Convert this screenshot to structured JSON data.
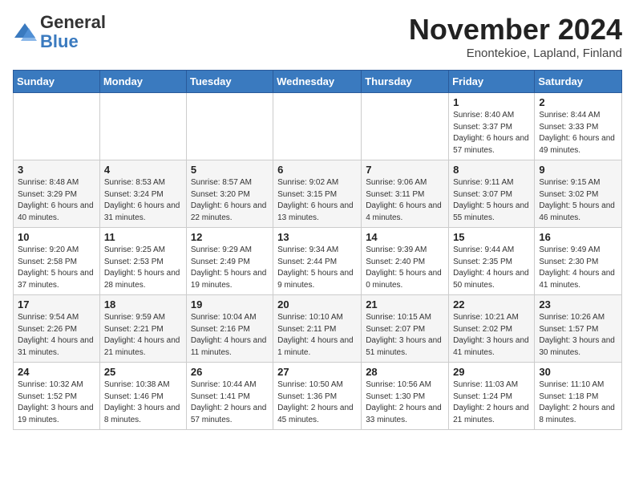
{
  "logo": {
    "general": "General",
    "blue": "Blue"
  },
  "header": {
    "month_year": "November 2024",
    "location": "Enontekioe, Lapland, Finland"
  },
  "days_of_week": [
    "Sunday",
    "Monday",
    "Tuesday",
    "Wednesday",
    "Thursday",
    "Friday",
    "Saturday"
  ],
  "weeks": [
    [
      {
        "day": "",
        "info": ""
      },
      {
        "day": "",
        "info": ""
      },
      {
        "day": "",
        "info": ""
      },
      {
        "day": "",
        "info": ""
      },
      {
        "day": "",
        "info": ""
      },
      {
        "day": "1",
        "info": "Sunrise: 8:40 AM\nSunset: 3:37 PM\nDaylight: 6 hours and 57 minutes."
      },
      {
        "day": "2",
        "info": "Sunrise: 8:44 AM\nSunset: 3:33 PM\nDaylight: 6 hours and 49 minutes."
      }
    ],
    [
      {
        "day": "3",
        "info": "Sunrise: 8:48 AM\nSunset: 3:29 PM\nDaylight: 6 hours and 40 minutes."
      },
      {
        "day": "4",
        "info": "Sunrise: 8:53 AM\nSunset: 3:24 PM\nDaylight: 6 hours and 31 minutes."
      },
      {
        "day": "5",
        "info": "Sunrise: 8:57 AM\nSunset: 3:20 PM\nDaylight: 6 hours and 22 minutes."
      },
      {
        "day": "6",
        "info": "Sunrise: 9:02 AM\nSunset: 3:15 PM\nDaylight: 6 hours and 13 minutes."
      },
      {
        "day": "7",
        "info": "Sunrise: 9:06 AM\nSunset: 3:11 PM\nDaylight: 6 hours and 4 minutes."
      },
      {
        "day": "8",
        "info": "Sunrise: 9:11 AM\nSunset: 3:07 PM\nDaylight: 5 hours and 55 minutes."
      },
      {
        "day": "9",
        "info": "Sunrise: 9:15 AM\nSunset: 3:02 PM\nDaylight: 5 hours and 46 minutes."
      }
    ],
    [
      {
        "day": "10",
        "info": "Sunrise: 9:20 AM\nSunset: 2:58 PM\nDaylight: 5 hours and 37 minutes."
      },
      {
        "day": "11",
        "info": "Sunrise: 9:25 AM\nSunset: 2:53 PM\nDaylight: 5 hours and 28 minutes."
      },
      {
        "day": "12",
        "info": "Sunrise: 9:29 AM\nSunset: 2:49 PM\nDaylight: 5 hours and 19 minutes."
      },
      {
        "day": "13",
        "info": "Sunrise: 9:34 AM\nSunset: 2:44 PM\nDaylight: 5 hours and 9 minutes."
      },
      {
        "day": "14",
        "info": "Sunrise: 9:39 AM\nSunset: 2:40 PM\nDaylight: 5 hours and 0 minutes."
      },
      {
        "day": "15",
        "info": "Sunrise: 9:44 AM\nSunset: 2:35 PM\nDaylight: 4 hours and 50 minutes."
      },
      {
        "day": "16",
        "info": "Sunrise: 9:49 AM\nSunset: 2:30 PM\nDaylight: 4 hours and 41 minutes."
      }
    ],
    [
      {
        "day": "17",
        "info": "Sunrise: 9:54 AM\nSunset: 2:26 PM\nDaylight: 4 hours and 31 minutes."
      },
      {
        "day": "18",
        "info": "Sunrise: 9:59 AM\nSunset: 2:21 PM\nDaylight: 4 hours and 21 minutes."
      },
      {
        "day": "19",
        "info": "Sunrise: 10:04 AM\nSunset: 2:16 PM\nDaylight: 4 hours and 11 minutes."
      },
      {
        "day": "20",
        "info": "Sunrise: 10:10 AM\nSunset: 2:11 PM\nDaylight: 4 hours and 1 minute."
      },
      {
        "day": "21",
        "info": "Sunrise: 10:15 AM\nSunset: 2:07 PM\nDaylight: 3 hours and 51 minutes."
      },
      {
        "day": "22",
        "info": "Sunrise: 10:21 AM\nSunset: 2:02 PM\nDaylight: 3 hours and 41 minutes."
      },
      {
        "day": "23",
        "info": "Sunrise: 10:26 AM\nSunset: 1:57 PM\nDaylight: 3 hours and 30 minutes."
      }
    ],
    [
      {
        "day": "24",
        "info": "Sunrise: 10:32 AM\nSunset: 1:52 PM\nDaylight: 3 hours and 19 minutes."
      },
      {
        "day": "25",
        "info": "Sunrise: 10:38 AM\nSunset: 1:46 PM\nDaylight: 3 hours and 8 minutes."
      },
      {
        "day": "26",
        "info": "Sunrise: 10:44 AM\nSunset: 1:41 PM\nDaylight: 2 hours and 57 minutes."
      },
      {
        "day": "27",
        "info": "Sunrise: 10:50 AM\nSunset: 1:36 PM\nDaylight: 2 hours and 45 minutes."
      },
      {
        "day": "28",
        "info": "Sunrise: 10:56 AM\nSunset: 1:30 PM\nDaylight: 2 hours and 33 minutes."
      },
      {
        "day": "29",
        "info": "Sunrise: 11:03 AM\nSunset: 1:24 PM\nDaylight: 2 hours and 21 minutes."
      },
      {
        "day": "30",
        "info": "Sunrise: 11:10 AM\nSunset: 1:18 PM\nDaylight: 2 hours and 8 minutes."
      }
    ]
  ]
}
